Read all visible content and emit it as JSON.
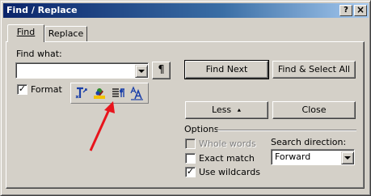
{
  "window": {
    "title": "Find / Replace",
    "help_glyph": "?",
    "close_glyph": "×"
  },
  "tabs": [
    {
      "label": "Find",
      "active": true
    },
    {
      "label": "Replace",
      "active": false
    }
  ],
  "find": {
    "label": "Find what:",
    "value": "",
    "pilcrow_button": "¶"
  },
  "format": {
    "label": "Format",
    "checked": true,
    "check_glyph": "✓"
  },
  "toolbar": {
    "icons": [
      "style-icon",
      "highlight-icon",
      "paragraph-format-icon",
      "character-format-icon"
    ]
  },
  "buttons": {
    "find_next": "Find Next",
    "find_select_all": "Find & Select All",
    "less": "Less",
    "less_arrow": "⯅",
    "close": "Close"
  },
  "options": {
    "group_label": "Options",
    "whole_words": {
      "label": "Whole words",
      "checked": false,
      "enabled": false
    },
    "exact_match": {
      "label": "Exact match",
      "checked": false,
      "enabled": true
    },
    "use_wildcards": {
      "label": "Use wildcards",
      "checked": true,
      "enabled": true
    }
  },
  "search_direction": {
    "label": "Search direction:",
    "value": "Forward"
  },
  "annotation": {
    "arrow_color": "#e8141c"
  },
  "colors": {
    "titlebar_start": "#0a246a",
    "titlebar_end": "#a6caf0",
    "face": "#d4d0c8"
  }
}
